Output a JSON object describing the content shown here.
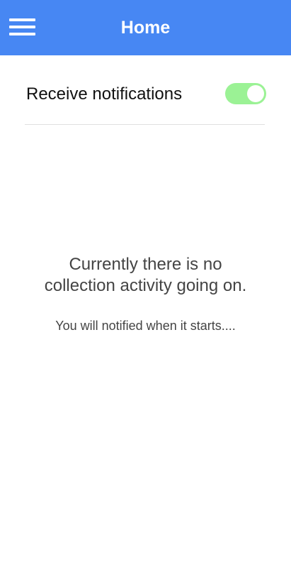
{
  "header": {
    "title": "Home",
    "menu_icon": "hamburger-menu-icon",
    "background_color": "#4787f3"
  },
  "settings": {
    "notifications_label": "Receive notifications",
    "notifications_enabled": true,
    "toggle_on_color": "#9bf295"
  },
  "empty_state": {
    "line1": "Currently there is no",
    "line2": "collection activity going on.",
    "subtext": "You will notified when it starts...."
  }
}
